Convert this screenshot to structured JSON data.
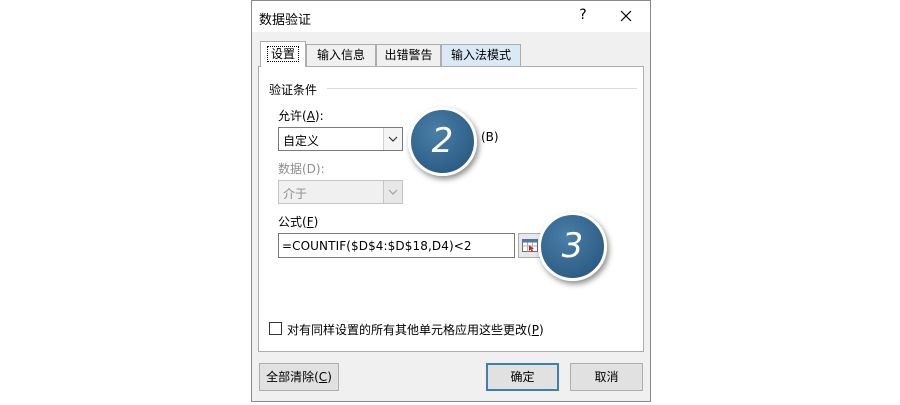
{
  "window": {
    "title": "数据验证",
    "help_label": "?"
  },
  "tabs": [
    {
      "label": "设置",
      "active": true
    },
    {
      "label": "输入信息"
    },
    {
      "label": "出错警告"
    },
    {
      "label": "输入法模式"
    }
  ],
  "settings": {
    "group_title": "验证条件",
    "allow": {
      "label": "允许(",
      "hotkey": "A",
      "label_end": "):",
      "value": "自定义"
    },
    "ignore_blank_suffix": "(B)",
    "data": {
      "label": "数据(D):",
      "value": "介于"
    },
    "formula": {
      "label": "公式(",
      "hotkey": "F",
      "label_end": ")",
      "value": "=COUNTIF($D$4:$D$18,D4)<2"
    },
    "apply_all": {
      "label": "对有同样设置的所有其他单元格应用这些更改(",
      "hotkey": "P",
      "label_end": ")",
      "checked": false
    }
  },
  "badges": [
    "2",
    "3"
  ],
  "buttons": {
    "clear_all": {
      "label": "全部清除(",
      "hotkey": "C",
      "label_end": ")"
    },
    "ok": "确定",
    "cancel": "取消"
  },
  "icons": {
    "close": "close-icon",
    "dropdown": "chevron-down-icon",
    "range_select": "range-select-icon"
  }
}
